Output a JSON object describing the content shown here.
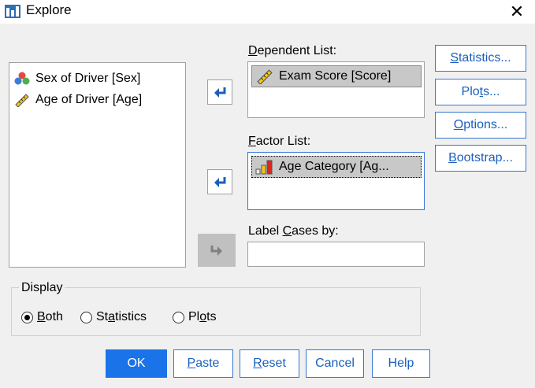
{
  "window": {
    "title": "Explore",
    "close_glyph": "✕"
  },
  "variables": [
    {
      "label": "Sex of Driver [Sex]",
      "icon": "nominal-variable-icon"
    },
    {
      "label": "Age of Driver [Age]",
      "icon": "scale-ruler-icon"
    }
  ],
  "dependent_list": {
    "label_pre": "",
    "label_key": "D",
    "label_post": "ependent List:",
    "items": [
      {
        "label": "Exam Score [Score]",
        "icon": "scale-ruler-icon"
      }
    ]
  },
  "factor_list": {
    "label_pre": "",
    "label_key": "F",
    "label_post": "actor List:",
    "items": [
      {
        "label": "Age Category [Ag...",
        "icon": "ordinal-bar-icon"
      }
    ]
  },
  "label_cases": {
    "label_pre": "Label ",
    "label_key": "C",
    "label_post": "ases by:",
    "value": ""
  },
  "side_buttons": {
    "statistics": {
      "pre": "",
      "key": "S",
      "post": "tatistics..."
    },
    "plots": {
      "pre": "Plo",
      "key": "t",
      "post": "s..."
    },
    "options": {
      "pre": "",
      "key": "O",
      "post": "ptions..."
    },
    "bootstrap": {
      "pre": "",
      "key": "B",
      "post": "ootstrap..."
    }
  },
  "display": {
    "label": "Display",
    "selected": "Both",
    "options": {
      "both": {
        "pre": "",
        "key": "B",
        "post": "oth"
      },
      "statistics": {
        "pre": "St",
        "key": "a",
        "post": "tistics"
      },
      "plots": {
        "pre": "Pl",
        "key": "o",
        "post": "ts"
      }
    }
  },
  "bottom_buttons": {
    "ok": "OK",
    "paste": {
      "pre": "",
      "key": "P",
      "post": "aste"
    },
    "reset": {
      "pre": "",
      "key": "R",
      "post": "eset"
    },
    "cancel": "Cancel",
    "help": "Help"
  },
  "colors": {
    "accent": "#1a73e8",
    "button_border": "#3278d2",
    "selection": "#c8c8c8"
  }
}
